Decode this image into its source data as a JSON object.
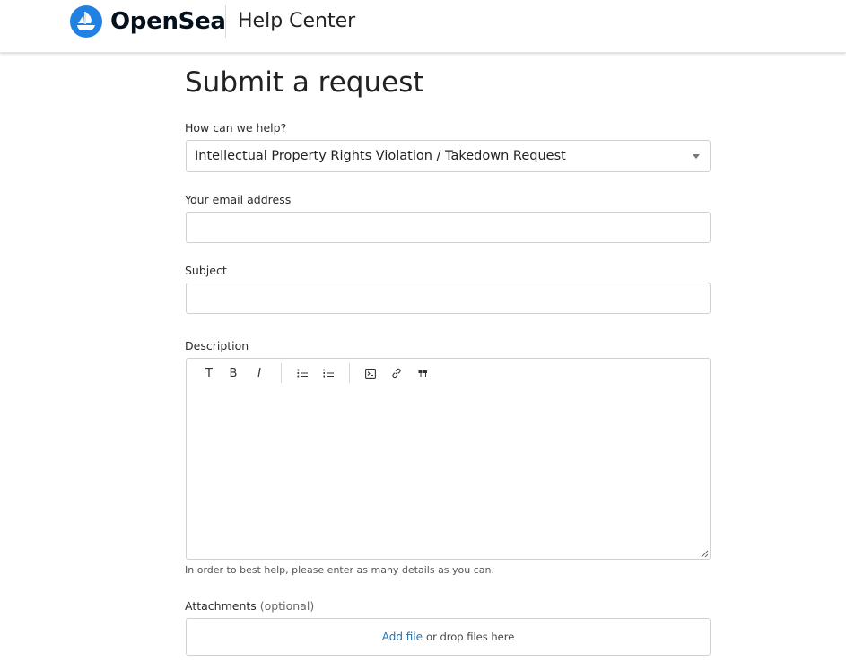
{
  "header": {
    "brand": "OpenSea",
    "section": "Help Center",
    "brand_color": "#2081e2"
  },
  "form": {
    "title": "Submit a request",
    "help_label": "How can we help?",
    "help_selected": "Intellectual Property Rights Violation / Takedown Request",
    "email_label": "Your email address",
    "email_value": "",
    "subject_label": "Subject",
    "subject_value": "",
    "description_label": "Description",
    "description_hint": "In order to best help, please enter as many details as you can.",
    "toolbar": {
      "text_format": "T",
      "bold": "B",
      "italic": "I",
      "icons": [
        "bulleted-list-icon",
        "numbered-list-icon",
        "code-block-icon",
        "link-icon",
        "quote-icon"
      ]
    },
    "attachments_label": "Attachments",
    "attachments_optional": "(optional)",
    "add_file": "Add file",
    "drop_text": "or drop files here"
  }
}
